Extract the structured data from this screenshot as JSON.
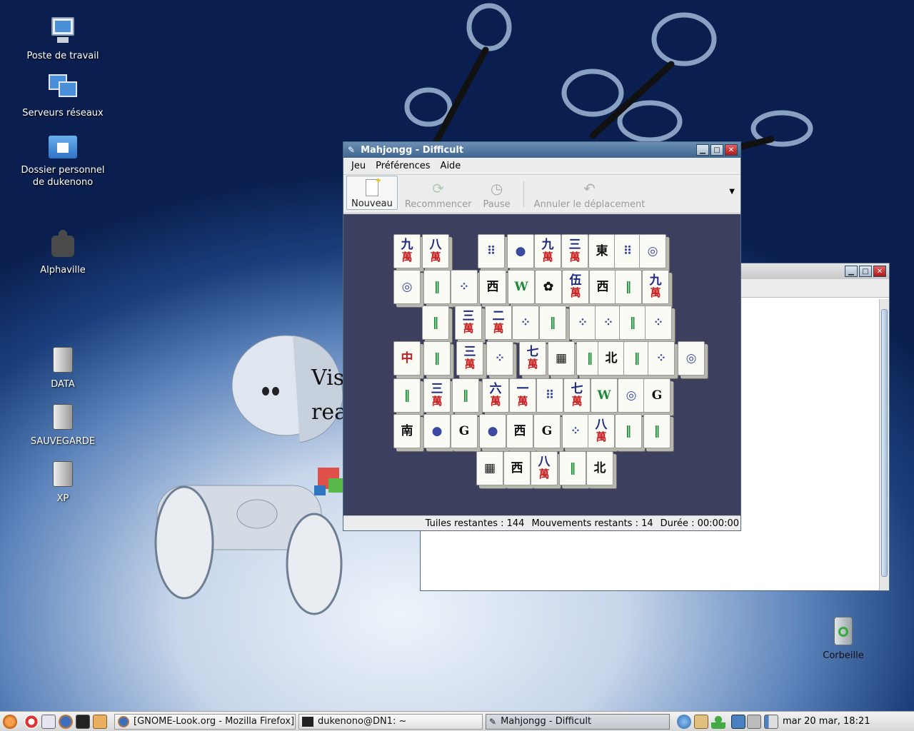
{
  "desktop": {
    "icons": [
      {
        "label": "Poste de travail",
        "icon": "computer-icon"
      },
      {
        "label": "Serveurs réseaux",
        "icon": "network-servers-icon"
      },
      {
        "label": "Dossier personnel de dukenono",
        "icon": "home-folder-icon"
      },
      {
        "label": "Alphaville",
        "icon": "puzzle-icon"
      },
      {
        "label": "DATA",
        "icon": "hard-drive-icon"
      },
      {
        "label": "SAUVEGARDE",
        "icon": "hard-drive-icon"
      },
      {
        "label": "XP",
        "icon": "hard-drive-icon"
      },
      {
        "label": "Corbeille",
        "icon": "trash-icon"
      }
    ],
    "wallpaper_text": "Vis\nrea"
  },
  "mahjongg": {
    "title": "Mahjongg - Difficult",
    "menu": [
      "Jeu",
      "Préférences",
      "Aide"
    ],
    "toolbar": [
      {
        "label": "Nouveau",
        "enabled": true
      },
      {
        "label": "Recommencer",
        "enabled": false
      },
      {
        "label": "Pause",
        "enabled": false
      },
      {
        "label": "Annuler le déplacement",
        "enabled": false
      }
    ],
    "status": {
      "tiles": "Tuiles restantes : 144",
      "moves": "Mouvements restants : 14",
      "time": "Durée : 00:00:00"
    },
    "board_color": "#3c3f5e",
    "tiles": [
      [
        "九",
        "萬"
      ],
      [
        "八",
        "萬"
      ],
      [
        "⠿",
        ""
      ],
      [
        "●",
        ""
      ],
      [
        "九",
        "萬"
      ],
      [
        "三",
        "萬"
      ],
      [
        "東",
        ""
      ],
      [
        "⠿",
        ""
      ],
      [
        "◎",
        ""
      ],
      [
        "◎",
        ""
      ],
      [
        "‖",
        ""
      ],
      [
        "⁘",
        ""
      ],
      [
        "西",
        ""
      ],
      [
        "W",
        ""
      ],
      [
        "✿",
        ""
      ],
      [
        "伍",
        "萬"
      ],
      [
        "西",
        ""
      ],
      [
        "‖",
        ""
      ],
      [
        "九",
        "萬"
      ],
      [
        "‖",
        ""
      ],
      [
        "三",
        "萬"
      ],
      [
        "二",
        "萬"
      ],
      [
        "⁘",
        ""
      ],
      [
        "‖",
        ""
      ],
      [
        "⁘",
        ""
      ],
      [
        "⁘",
        ""
      ],
      [
        "‖",
        ""
      ],
      [
        "⁘",
        ""
      ],
      [
        "中",
        ""
      ],
      [
        "‖",
        ""
      ],
      [
        "三",
        "萬"
      ],
      [
        "⁘",
        ""
      ],
      [
        "七",
        "萬"
      ],
      [
        "▦",
        ""
      ],
      [
        "‖",
        ""
      ],
      [
        "北",
        ""
      ],
      [
        "‖",
        ""
      ],
      [
        "⁘",
        ""
      ],
      [
        "◎",
        ""
      ],
      [
        "‖",
        ""
      ],
      [
        "三",
        "萬"
      ],
      [
        "‖",
        ""
      ],
      [
        "六",
        "萬"
      ],
      [
        "一",
        "萬"
      ],
      [
        "⠿",
        ""
      ],
      [
        "七",
        "萬"
      ],
      [
        "W",
        ""
      ],
      [
        "◎",
        ""
      ],
      [
        "G",
        ""
      ],
      [
        "南",
        ""
      ],
      [
        "●",
        ""
      ],
      [
        "G",
        ""
      ],
      [
        "●",
        ""
      ],
      [
        "西",
        ""
      ],
      [
        "G",
        ""
      ],
      [
        "⁘",
        ""
      ],
      [
        "八",
        "萬"
      ],
      [
        "‖",
        ""
      ],
      [
        "‖",
        ""
      ],
      [
        "▦",
        ""
      ],
      [
        "西",
        ""
      ],
      [
        "八",
        "萬"
      ],
      [
        "‖",
        ""
      ],
      [
        "北",
        ""
      ]
    ]
  },
  "bg_window": {
    "title": ""
  },
  "panel": {
    "tasks": [
      "[GNOME-Look.org - Mozilla Firefox]",
      "dukenono@DN1: ~",
      "Mahjongg - Difficult"
    ],
    "clock": "mar 20 mar, 18:21"
  }
}
